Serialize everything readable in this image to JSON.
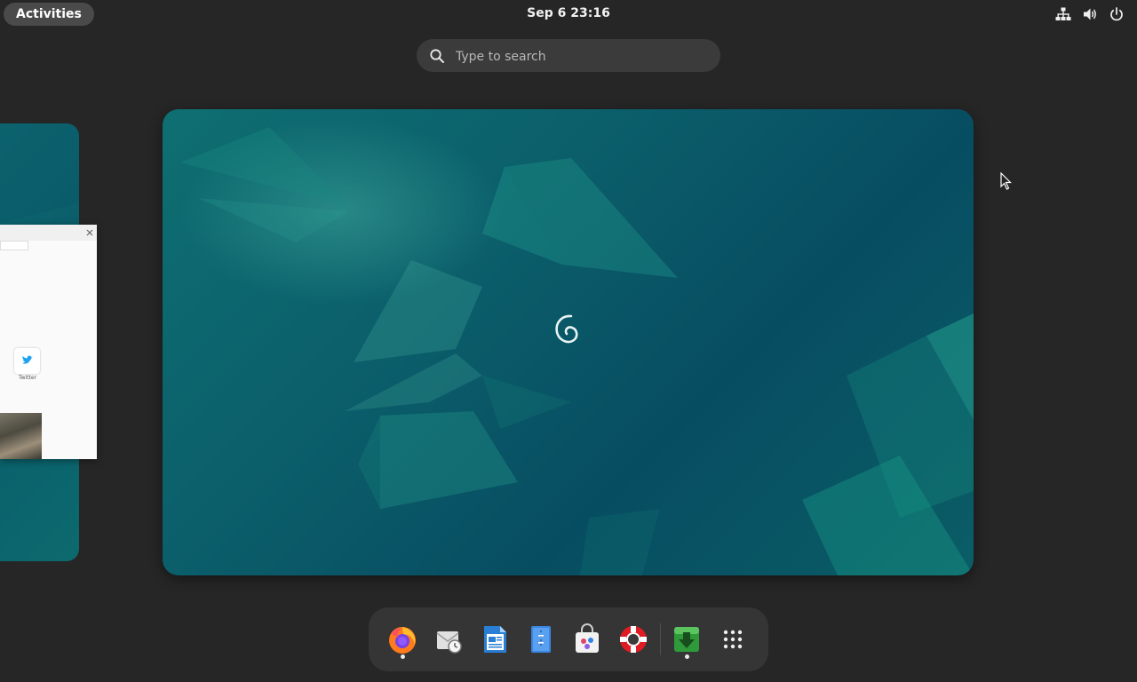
{
  "topbar": {
    "activities_label": "Activities",
    "clock": "Sep 6  23:16",
    "status_icons": [
      "network-icon",
      "volume-icon",
      "power-icon"
    ]
  },
  "search": {
    "placeholder": "Type to search"
  },
  "thumbnail": {
    "twitter_label": "Twitter"
  },
  "dash": {
    "apps": [
      {
        "name": "firefox-icon",
        "running": true
      },
      {
        "name": "evolution-mail-icon",
        "running": false
      },
      {
        "name": "libreoffice-writer-icon",
        "running": false
      },
      {
        "name": "text-editor-icon",
        "running": false
      },
      {
        "name": "software-center-icon",
        "running": false
      },
      {
        "name": "help-icon",
        "running": false
      },
      {
        "name": "software-updater-icon",
        "running": true
      },
      {
        "name": "app-grid-icon",
        "running": false
      }
    ]
  },
  "colors": {
    "background": "#262626",
    "workspace_teal": "#0b5f6b",
    "dash": "#353535"
  }
}
